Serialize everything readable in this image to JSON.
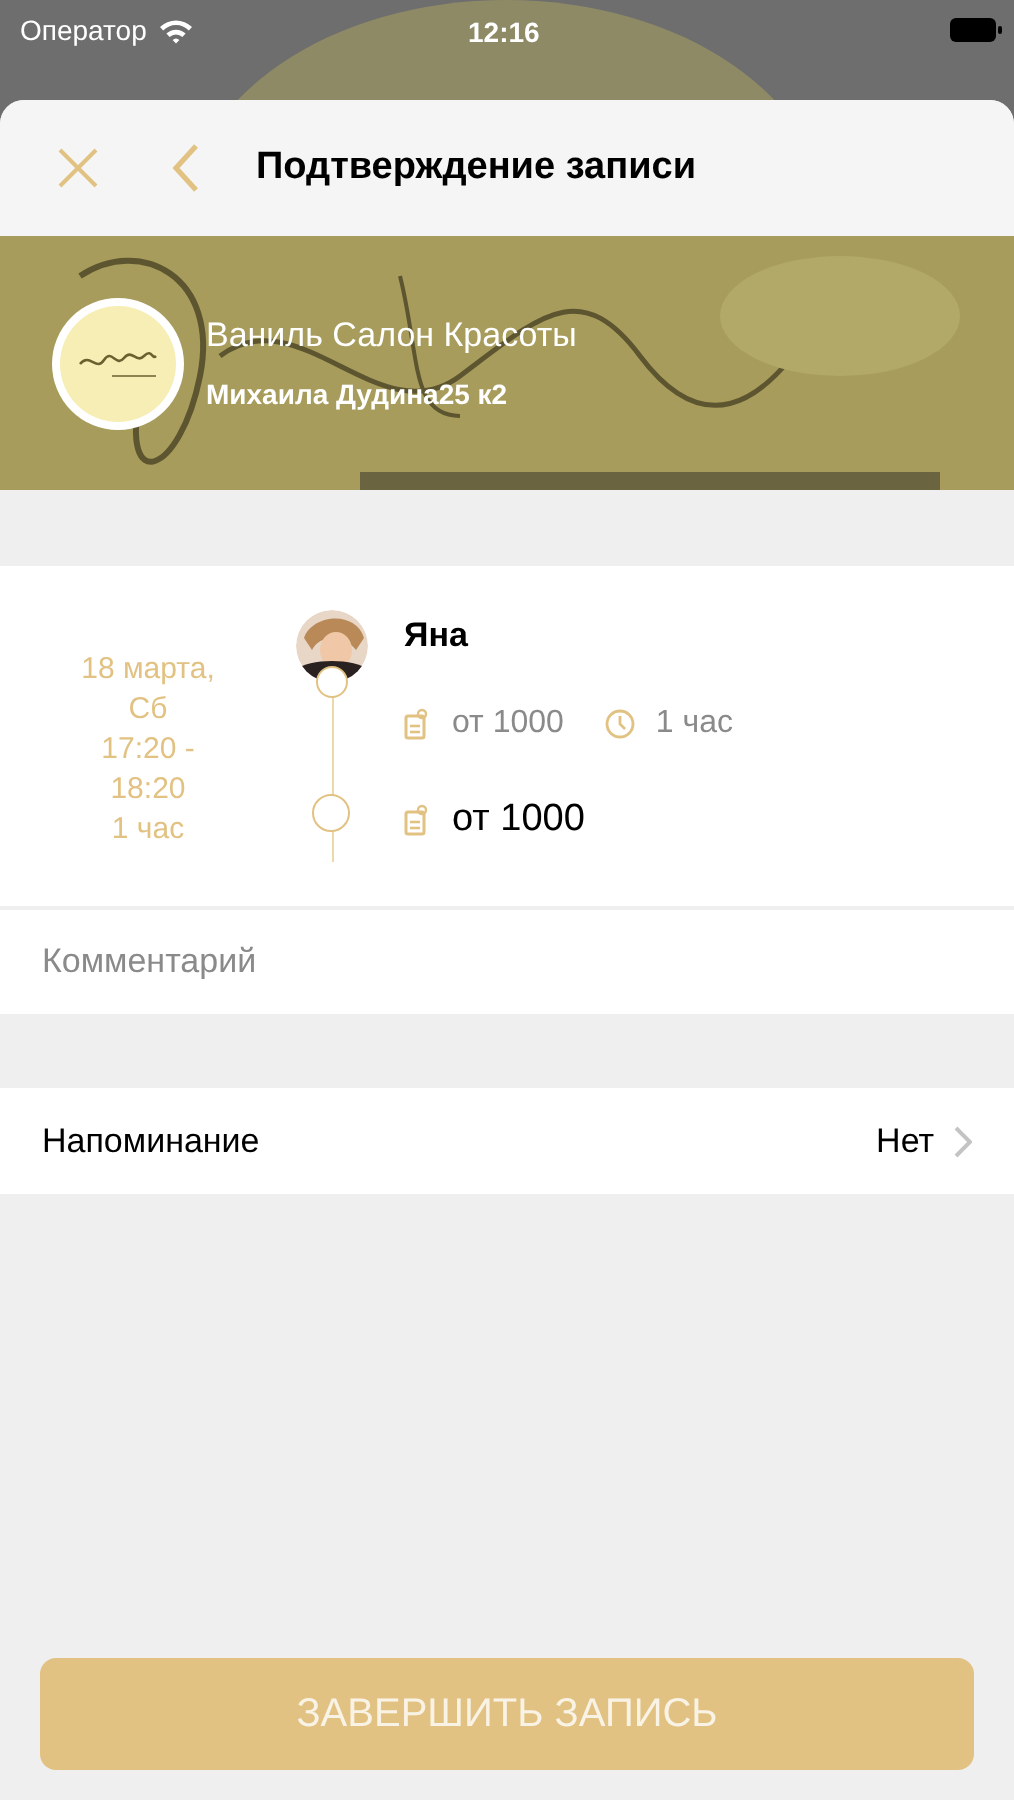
{
  "status_bar": {
    "carrier": "Оператор",
    "time": "12:16"
  },
  "header": {
    "title": "Подтверждение записи"
  },
  "salon": {
    "name": "Ваниль Салон Красоты",
    "address": "Михаила Дудина25 к2"
  },
  "booking": {
    "date_lines": [
      "18 марта,",
      "Сб",
      "17:20 -",
      "18:20",
      "1 час"
    ],
    "master": {
      "name": "Яна"
    },
    "items": [
      {
        "kind": "master_service",
        "price": "от 1000",
        "duration": "1 час"
      },
      {
        "kind": "service",
        "price": "от 1000"
      }
    ]
  },
  "comment": {
    "placeholder": "Комментарий"
  },
  "reminder": {
    "label": "Напоминание",
    "value": "Нет"
  },
  "submit": {
    "label": "ЗАВЕРШИТЬ ЗАПИСЬ",
    "disabled": true
  }
}
